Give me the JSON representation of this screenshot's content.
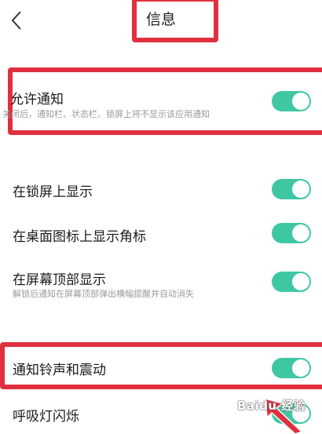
{
  "header": {
    "title": "信息"
  },
  "settings": {
    "allow_notify": {
      "label": "允许通知",
      "desc": "关闭后，通知栏、状态栏、锁屏上将不显示该应用通知",
      "on": true
    },
    "lockscreen": {
      "label": "在锁屏上显示",
      "on": true
    },
    "badge": {
      "label": "在桌面图标上显示角标",
      "on": true
    },
    "top_banner": {
      "label": "在屏幕顶部显示",
      "desc": "解锁后通知在屏幕顶部弹出横幅提醒并自动消失",
      "on": true
    },
    "ringtone": {
      "label": "通知铃声和震动",
      "on": true
    },
    "breath_light": {
      "label": "呼吸灯闪烁",
      "on": true
    }
  },
  "watermark": {
    "text": "Baidu 经验"
  },
  "colors": {
    "toggle_on": "#3fc7a4",
    "highlight": "#e0303f"
  }
}
